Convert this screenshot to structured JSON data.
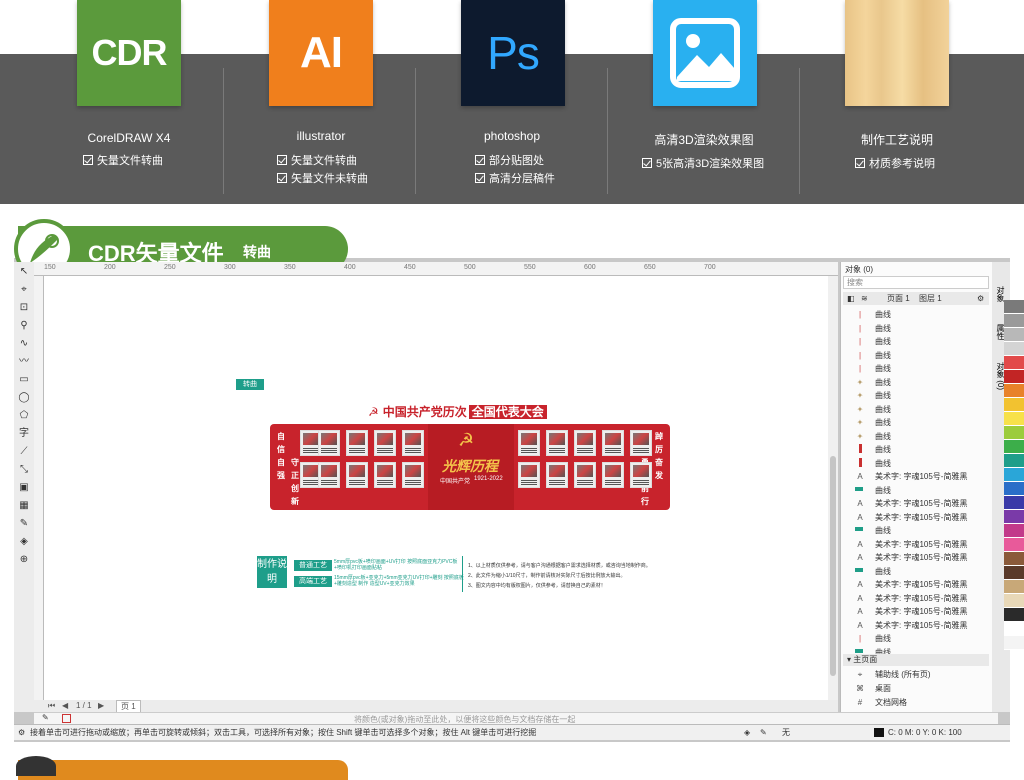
{
  "software": [
    {
      "label": "CDR",
      "title": "CorelDRAW X4",
      "items": [
        "矢量文件转曲"
      ],
      "color": "#5b9a3c"
    },
    {
      "label": "AI",
      "title": "illustrator",
      "items": [
        "矢量文件转曲",
        "矢量文件未转曲"
      ],
      "color": "#f07f1c"
    },
    {
      "label": "Ps",
      "title": "photoshop",
      "items": [
        "部分贴图处",
        "高清分层稿件"
      ],
      "color": "#0d1a2e"
    },
    {
      "label": "",
      "title": "高清3D渲染效果图",
      "items": [
        "5张高清3D渲染效果图"
      ],
      "color": "#29b0f0"
    },
    {
      "label": "",
      "title": "制作工艺说明",
      "items": [
        "材质参考说明"
      ],
      "color": "#e8c486"
    }
  ],
  "section": {
    "title": "CDR矢量文件",
    "subtitle": "转曲"
  },
  "ruler": [
    "150",
    "200",
    "250",
    "300",
    "350",
    "400",
    "450",
    "500",
    "550",
    "600",
    "650",
    "700"
  ],
  "objects_panel": {
    "title": "对象 (0)",
    "search": "搜索",
    "page": "页面 1",
    "layer": "图层 1",
    "rows": [
      {
        "icon": "line",
        "label": "曲线"
      },
      {
        "icon": "line",
        "label": "曲线"
      },
      {
        "icon": "line",
        "label": "曲线"
      },
      {
        "icon": "line",
        "label": "曲线"
      },
      {
        "icon": "line",
        "label": "曲线"
      },
      {
        "icon": "glyph",
        "label": "曲线"
      },
      {
        "icon": "glyph",
        "label": "曲线"
      },
      {
        "icon": "glyph",
        "label": "曲线"
      },
      {
        "icon": "glyph",
        "label": "曲线"
      },
      {
        "icon": "glyph",
        "label": "曲线"
      },
      {
        "icon": "bar",
        "label": "曲线"
      },
      {
        "icon": "bar",
        "label": "曲线"
      },
      {
        "icon": "A",
        "label": "美术字: 字魂105号-简雅黑"
      },
      {
        "icon": "green",
        "label": "曲线"
      },
      {
        "icon": "A",
        "label": "美术字: 字魂105号-简雅黑"
      },
      {
        "icon": "A",
        "label": "美术字: 字魂105号-简雅黑"
      },
      {
        "icon": "green",
        "label": "曲线"
      },
      {
        "icon": "A",
        "label": "美术字: 字魂105号-简雅黑"
      },
      {
        "icon": "A",
        "label": "美术字: 字魂105号-简雅黑"
      },
      {
        "icon": "green",
        "label": "曲线"
      },
      {
        "icon": "A",
        "label": "美术字: 字魂105号-简雅黑"
      },
      {
        "icon": "A",
        "label": "美术字: 字魂105号-简雅黑"
      },
      {
        "icon": "A",
        "label": "美术字: 字魂105号-简雅黑"
      },
      {
        "icon": "A",
        "label": "美术字: 字魂105号-简雅黑"
      },
      {
        "icon": "line",
        "label": "曲线"
      },
      {
        "icon": "green",
        "label": "曲线"
      }
    ],
    "master_section": "主页面",
    "master_rows": [
      "辅助线 (所有页)",
      "桌面",
      "文档网格"
    ]
  },
  "right_tabs": [
    "对象",
    "属性",
    "对象 (0)"
  ],
  "design": {
    "tag": "转曲",
    "title_main": "中国共产党历次",
    "title_highlight": "全国代表大会",
    "center_title": "光辉历程",
    "center_sub": "中国共产党",
    "center_years": "1921-2022",
    "left_slogan": "自信自强",
    "left_slogan2": "守正创新",
    "right_slogan": "踔厉奋发",
    "right_slogan2": "勇毅前行",
    "make_label": "制作说明",
    "crafts": [
      {
        "label": "普通工艺",
        "desc": "5mm厚pvc板+喷印画面+UV打印 按照底面亚克力PVC板+喷印机打印画面贴粘"
      },
      {
        "label": "高端工艺",
        "desc": "15mm厚pvc板+亚克力+5mm亚克力UV打印+雕刻 按照底板+雕刻造型 制作 造型UV+亚克力效果"
      }
    ],
    "notes": [
      "1、以上材质仅供参考，请与客户沟通根据客户需求选择材质，或咨询当地制作商。",
      "2、此文件为缩小1/10尺寸，制作前请核对实际尺寸后按比例放大输出。",
      "3、图文内容中均有版权图片，仅供参考，请替换自己的素材！"
    ]
  },
  "pagebar": {
    "page_tab": "页 1",
    "page_info": "1 / 1"
  },
  "colorbar_hint": "将颜色(或对象)拖动至此处，以便将这些颜色与文档存储在一起",
  "status": {
    "hint": "接着单击可进行拖动或缩放；再单击可旋转或倾斜；双击工具，可选择所有对象；按住 Shift 键单击可选择多个对象；按住 Alt 键单击可进行挖掘",
    "fill": "无",
    "cmyk": "C: 0 M: 0 Y: 0 K: 100"
  }
}
